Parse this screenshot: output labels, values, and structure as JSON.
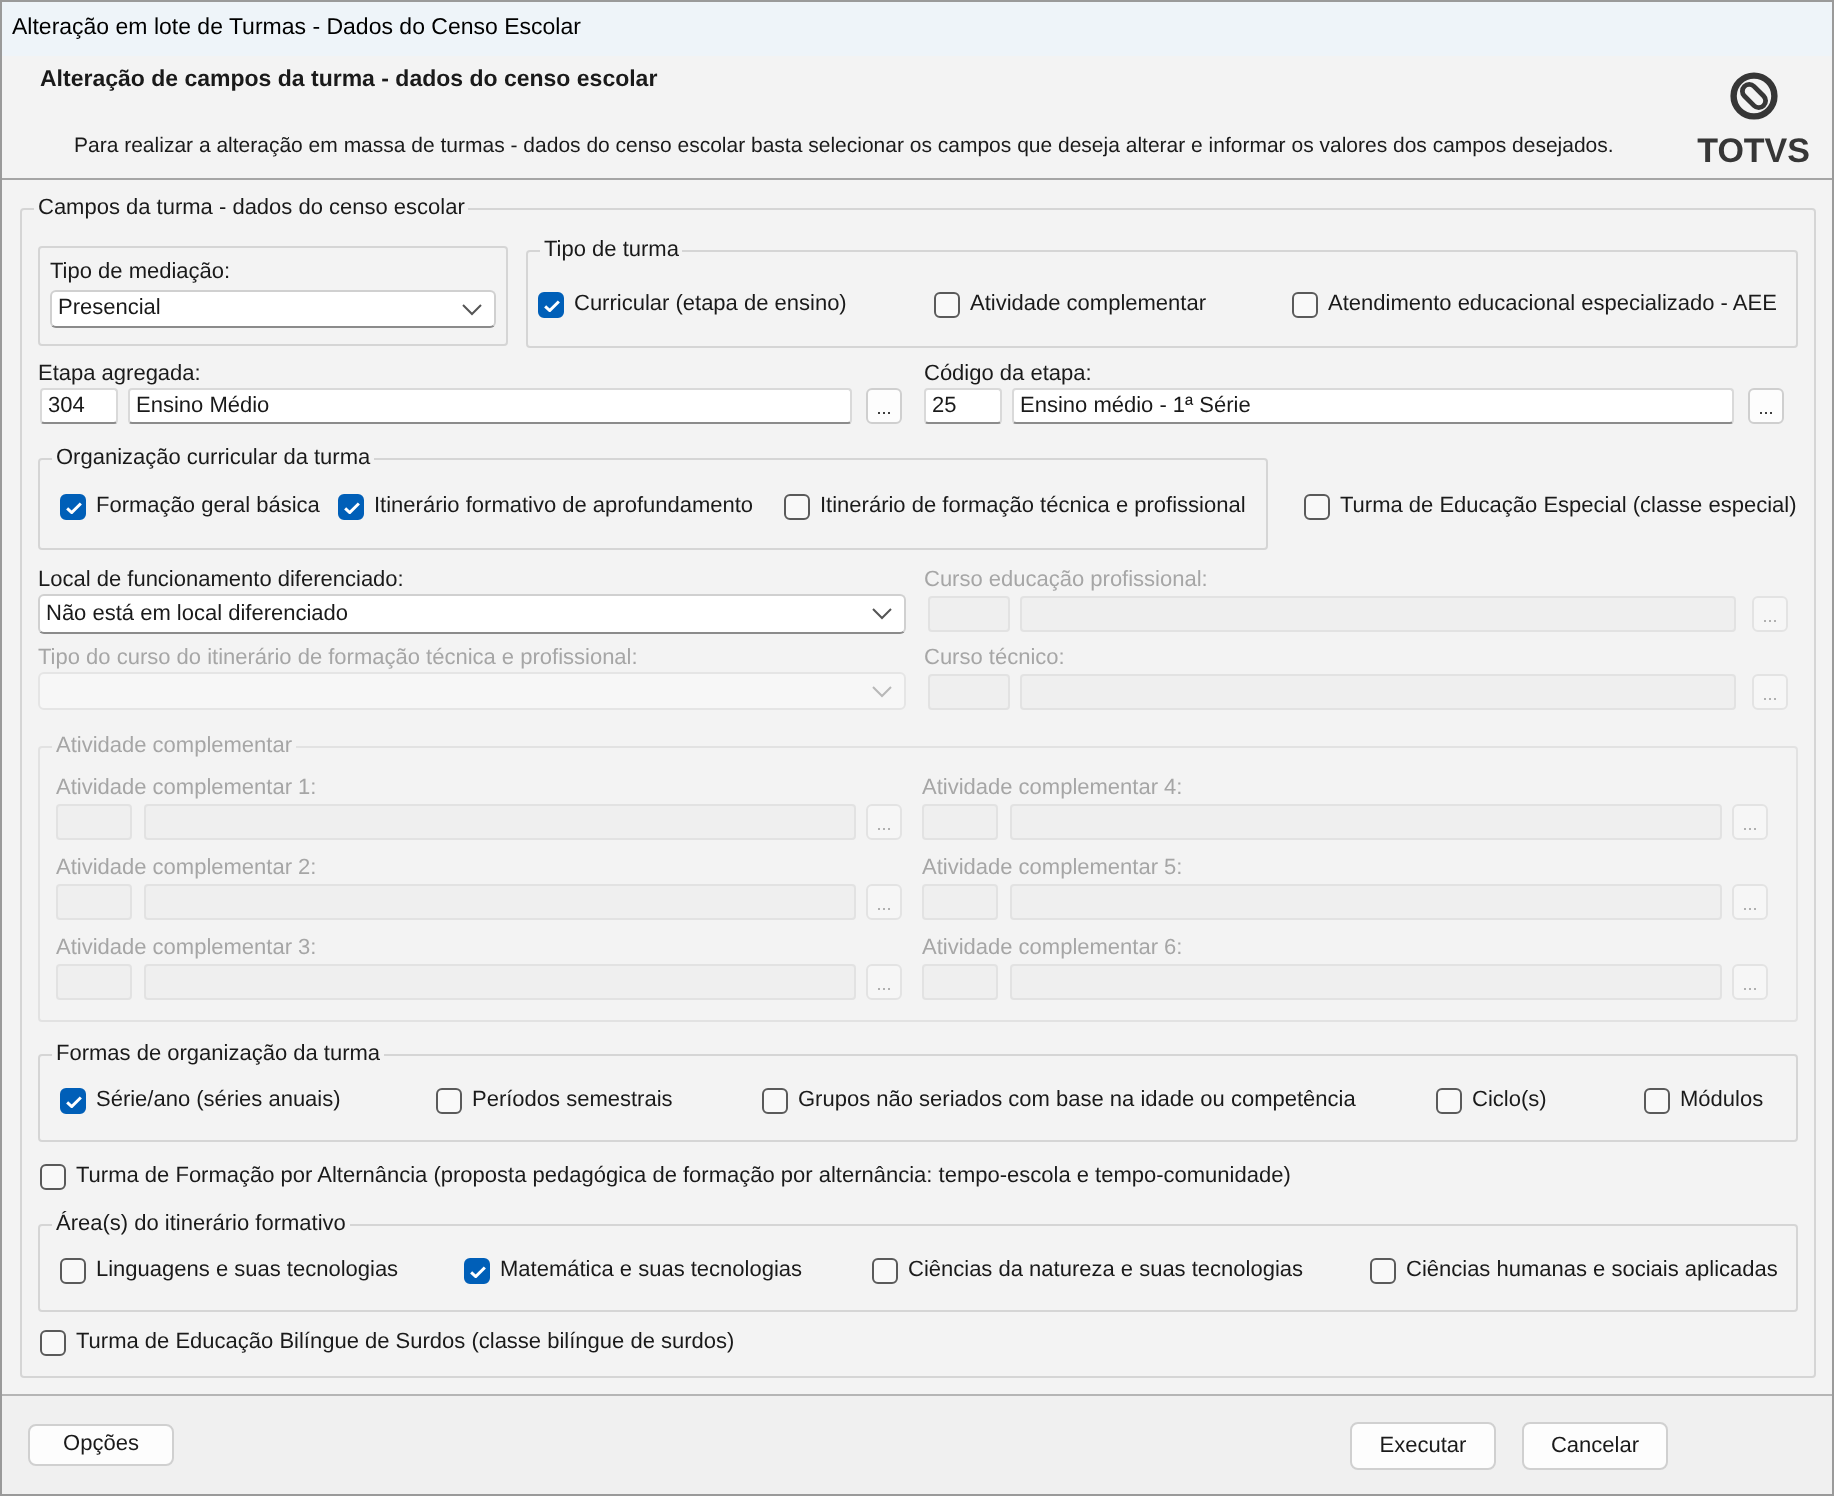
{
  "window": {
    "title": "Alteração em lote de Turmas - Dados do Censo Escolar"
  },
  "header": {
    "title": "Alteração de campos da turma - dados do censo escolar",
    "description": "Para realizar a alteração em massa de turmas - dados do censo escolar basta selecionar os campos que deseja alterar e informar os valores dos campos desejados.",
    "logo_text": "TOTVS"
  },
  "form": {
    "title": "Campos da turma - dados do censo escolar",
    "tipo_de_mediacao": {
      "label": "Tipo de mediação:",
      "value": "Presencial",
      "disabled": false
    },
    "tipo_de_turma": {
      "title": "Tipo de turma",
      "options": [
        {
          "label": "Curricular (etapa de ensino)",
          "checked": true
        },
        {
          "label": "Atividade complementar",
          "checked": false
        },
        {
          "label": "Atendimento educacional especializado - AEE",
          "checked": false
        }
      ]
    },
    "etapa_agregada": {
      "label": "Etapa agregada:",
      "code": "304",
      "name": "Ensino Médio",
      "button": "...",
      "disabled": false
    },
    "codigo_da_etapa": {
      "label": "Código da etapa:",
      "code": "25",
      "name": "Ensino médio - 1ª Série",
      "button": "...",
      "disabled": false
    },
    "organizacao_curricular": {
      "title": "Organização curricular da turma",
      "options": [
        {
          "label": "Formação geral básica",
          "checked": true
        },
        {
          "label": "Itinerário formativo de aprofundamento",
          "checked": true
        },
        {
          "label": "Itinerário de formação técnica e profissional",
          "checked": false
        }
      ]
    },
    "turma_educacao_especial": {
      "label": "Turma de Educação Especial (classe especial)",
      "checked": false
    },
    "local_de_funcionamento": {
      "label": "Local de funcionamento diferenciado:",
      "value": "Não está em local diferenciado",
      "disabled": false
    },
    "curso_educacao_profissional": {
      "label": "Curso educação profissional:",
      "button": "...",
      "disabled": true
    },
    "tipo_do_curso": {
      "label": "Tipo do curso do itinerário de formação técnica e profissional:",
      "disabled": true
    },
    "curso_tecnico": {
      "label": "Curso técnico:",
      "button": "...",
      "disabled": true
    },
    "atividade_complementar": {
      "title": "Atividade complementar",
      "disabled": true,
      "fields": [
        {
          "label": "Atividade complementar 1:",
          "button": "...",
          "disabled": true
        },
        {
          "label": "Atividade complementar 2:",
          "button": "...",
          "disabled": true
        },
        {
          "label": "Atividade complementar 3:",
          "button": "...",
          "disabled": true
        },
        {
          "label": "Atividade complementar 4:",
          "button": "...",
          "disabled": true
        },
        {
          "label": "Atividade complementar 5:",
          "button": "...",
          "disabled": true
        },
        {
          "label": "Atividade complementar 6:",
          "button": "...",
          "disabled": true
        }
      ]
    },
    "formas_de_organizacao": {
      "title": "Formas de organização da turma",
      "options": [
        {
          "label": "Série/ano (séries anuais)",
          "checked": true
        },
        {
          "label": "Períodos semestrais",
          "checked": false
        },
        {
          "label": "Grupos não seriados com base na idade ou competência",
          "checked": false
        },
        {
          "label": "Ciclo(s)",
          "checked": false
        },
        {
          "label": "Módulos",
          "checked": false
        }
      ]
    },
    "turma_alternancia": {
      "label": "Turma de Formação por Alternância (proposta pedagógica de formação por alternância: tempo-escola e tempo-comunidade)",
      "checked": false
    },
    "areas_itinerario": {
      "title": "Área(s) do itinerário formativo",
      "options": [
        {
          "label": "Linguagens e suas tecnologias",
          "checked": false
        },
        {
          "label": "Matemática e suas tecnologias",
          "checked": true
        },
        {
          "label": "Ciências da natureza e suas tecnologias",
          "checked": false
        },
        {
          "label": "Ciências humanas e sociais aplicadas",
          "checked": false
        }
      ]
    },
    "turma_bilingue_surdos": {
      "label": "Turma de Educação Bilíngue de Surdos (classe bilíngue de surdos)",
      "checked": false
    }
  },
  "footer": {
    "options_button": "Opções",
    "buttons": [
      "Executar",
      "Cancelar"
    ]
  }
}
